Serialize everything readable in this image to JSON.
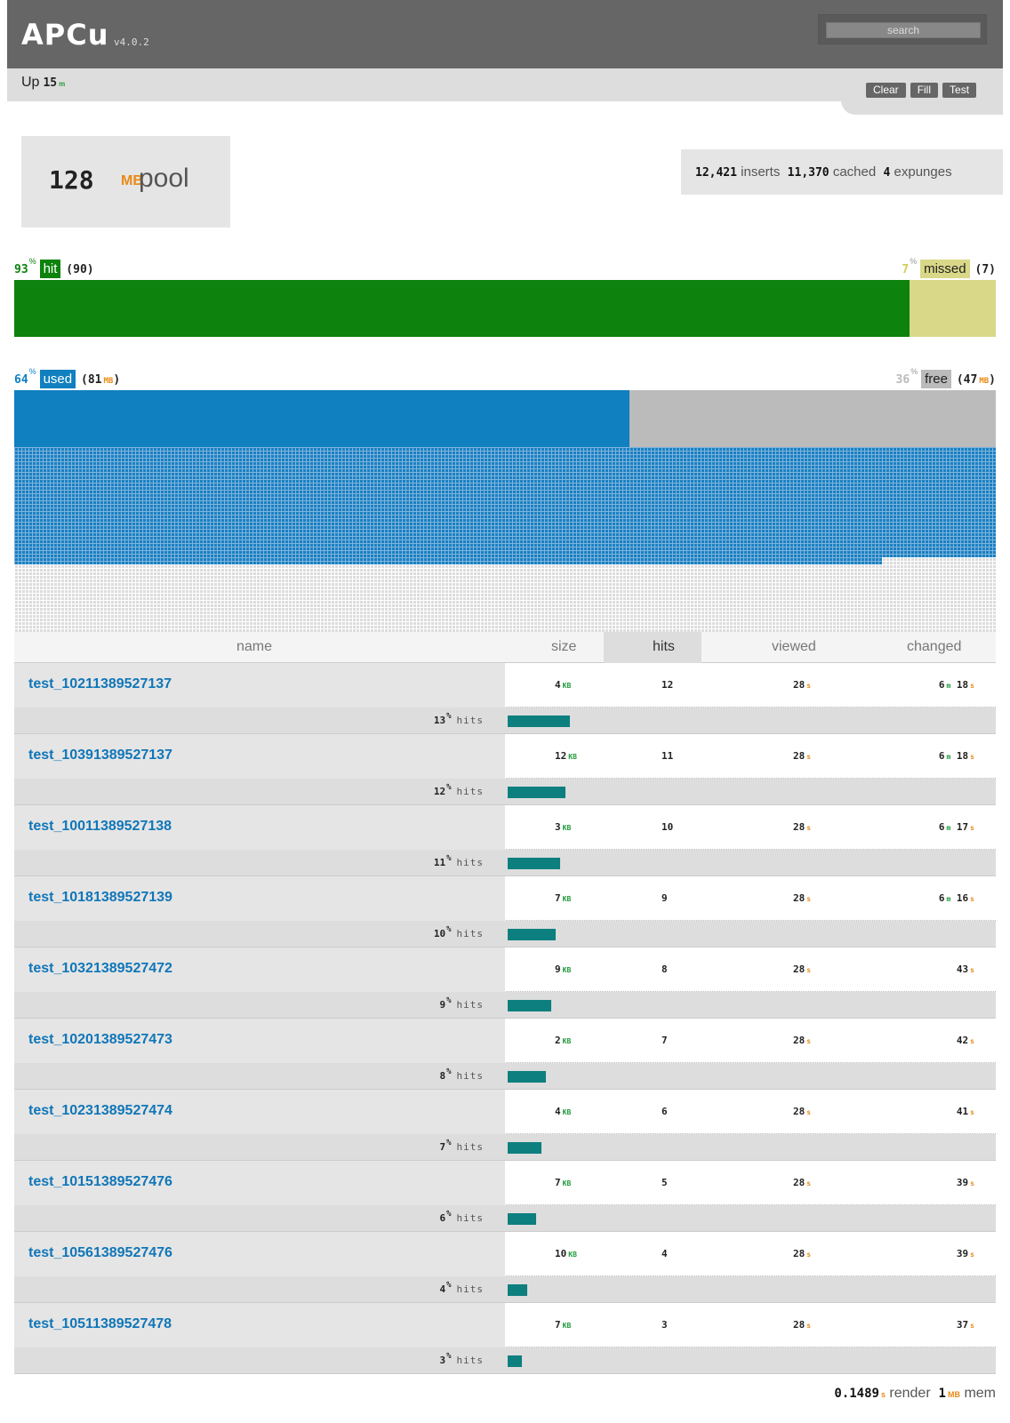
{
  "header": {
    "title": "APCu",
    "version": "v4.0.2",
    "search_placeholder": "search"
  },
  "subbar": {
    "uptime_label": "Up",
    "uptime_value": "15",
    "uptime_unit": "m"
  },
  "actions": [
    "Clear",
    "Fill",
    "Test"
  ],
  "pool": {
    "value": "128",
    "unit": "MB",
    "label": "pool"
  },
  "stats": {
    "inserts": "12,421",
    "inserts_label": "inserts",
    "cached": "11,370",
    "cached_label": "cached",
    "expunges": "4",
    "expunges_label": "expunges"
  },
  "hit_ratio": {
    "hit_pct": "93",
    "hit_label": "hit",
    "hit_count": "(90)",
    "miss_pct": "7",
    "miss_label": "missed",
    "miss_count": "(7)",
    "hit_fraction": 0.93
  },
  "memory": {
    "used_pct": "64",
    "used_label": "used",
    "used_value": "81",
    "free_pct": "36",
    "free_label": "free",
    "free_value": "47",
    "unit": "MB",
    "used_fraction": 0.64
  },
  "table": {
    "headers": [
      "name",
      "size",
      "hits",
      "viewed",
      "changed"
    ],
    "hits_label": "hits",
    "rows": [
      {
        "name": "test_10211389527137",
        "size": "4",
        "hits": "12",
        "viewed": "28",
        "changed_min": "6",
        "changed_sec": "18",
        "pct": "13",
        "fraction": 0.13
      },
      {
        "name": "test_10391389527137",
        "size": "12",
        "hits": "11",
        "viewed": "28",
        "changed_min": "6",
        "changed_sec": "18",
        "pct": "12",
        "fraction": 0.12
      },
      {
        "name": "test_10011389527138",
        "size": "3",
        "hits": "10",
        "viewed": "28",
        "changed_min": "6",
        "changed_sec": "17",
        "pct": "11",
        "fraction": 0.11
      },
      {
        "name": "test_10181389527139",
        "size": "7",
        "hits": "9",
        "viewed": "28",
        "changed_min": "6",
        "changed_sec": "16",
        "pct": "10",
        "fraction": 0.1
      },
      {
        "name": "test_10321389527472",
        "size": "9",
        "hits": "8",
        "viewed": "28",
        "changed_min": "",
        "changed_sec": "43",
        "pct": "9",
        "fraction": 0.09
      },
      {
        "name": "test_10201389527473",
        "size": "2",
        "hits": "7",
        "viewed": "28",
        "changed_min": "",
        "changed_sec": "42",
        "pct": "8",
        "fraction": 0.08
      },
      {
        "name": "test_10231389527474",
        "size": "4",
        "hits": "6",
        "viewed": "28",
        "changed_min": "",
        "changed_sec": "41",
        "pct": "7",
        "fraction": 0.07
      },
      {
        "name": "test_10151389527476",
        "size": "7",
        "hits": "5",
        "viewed": "28",
        "changed_min": "",
        "changed_sec": "39",
        "pct": "6",
        "fraction": 0.06
      },
      {
        "name": "test_10561389527476",
        "size": "10",
        "hits": "4",
        "viewed": "28",
        "changed_min": "",
        "changed_sec": "39",
        "pct": "4",
        "fraction": 0.04
      },
      {
        "name": "test_10511389527478",
        "size": "7",
        "hits": "3",
        "viewed": "28",
        "changed_min": "",
        "changed_sec": "37",
        "pct": "3",
        "fraction": 0.03
      }
    ],
    "units": {
      "size": "KB",
      "time": "s",
      "minutes": "m"
    }
  },
  "footer": {
    "render_value": "0.1489",
    "render_unit": "s",
    "render_label": "render",
    "mem_value": "1",
    "mem_unit": "MB",
    "mem_label": "mem"
  },
  "colors": {
    "hit": "#0d820d",
    "miss": "#d9d888",
    "used": "#1080c0",
    "free": "#bbb",
    "accent_unit": "#e88a15",
    "hit_bar": "#0e7f7f"
  }
}
